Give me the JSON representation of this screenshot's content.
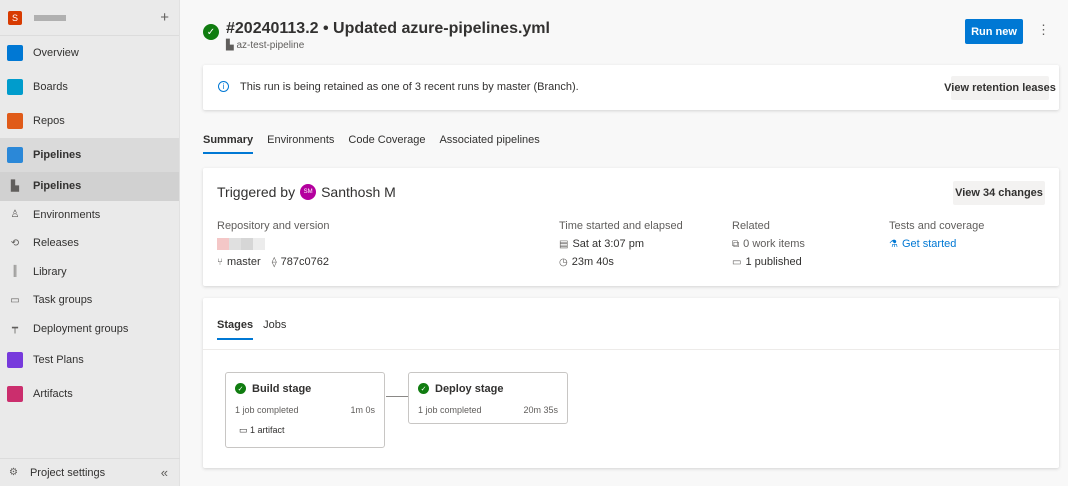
{
  "sidebar": {
    "org_letter": "S",
    "add_glyph": "+",
    "items": [
      {
        "label": "Overview",
        "icon": "overview-icon",
        "color": "#0078d4"
      },
      {
        "label": "Boards",
        "icon": "boards-icon",
        "color": "#009ccc"
      },
      {
        "label": "Repos",
        "icon": "repos-icon",
        "color": "#e05b19"
      },
      {
        "label": "Pipelines",
        "icon": "pipelines-icon",
        "color": "#2b88d8"
      }
    ],
    "sub_items": [
      {
        "label": "Pipelines",
        "icon": "pipelines-sub-icon"
      },
      {
        "label": "Environments",
        "icon": "environments-icon"
      },
      {
        "label": "Releases",
        "icon": "releases-icon"
      },
      {
        "label": "Library",
        "icon": "library-icon"
      },
      {
        "label": "Task groups",
        "icon": "task-groups-icon"
      },
      {
        "label": "Deployment groups",
        "icon": "deployment-groups-icon"
      }
    ],
    "items_after": [
      {
        "label": "Test Plans",
        "icon": "test-plans-icon",
        "color": "#773adc"
      },
      {
        "label": "Artifacts",
        "icon": "artifacts-icon",
        "color": "#cb2e6d"
      }
    ],
    "settings_label": "Project settings",
    "collapse_glyph": "«"
  },
  "header": {
    "title": "#20240113.2 • Updated azure-pipelines.yml",
    "pipeline_name": "az-test-pipeline",
    "run_new_label": "Run new",
    "more_glyph": "⋮"
  },
  "banner": {
    "text": "This run is being retained as one of 3 recent runs by master (Branch).",
    "button_label": "View retention leases"
  },
  "tabs": [
    "Summary",
    "Environments",
    "Code Coverage",
    "Associated pipelines"
  ],
  "summary": {
    "triggered_prefix": "Triggered by",
    "avatar_initials": "SM",
    "user_name": "Santhosh M",
    "changes_button": "View 34 changes",
    "repo_label": "Repository and version",
    "branch": "master",
    "commit": "787c0762",
    "time_label": "Time started and elapsed",
    "started": "Sat at 3:07 pm",
    "elapsed": "23m 40s",
    "related_label": "Related",
    "work_items": "0 work items",
    "published": "1 published",
    "tests_label": "Tests and coverage",
    "get_started": "Get started"
  },
  "stages_tabs": [
    "Stages",
    "Jobs"
  ],
  "stages": [
    {
      "name": "Build stage",
      "jobs": "1 job completed",
      "duration": "1m 0s",
      "artifact": "1 artifact"
    },
    {
      "name": "Deploy stage",
      "jobs": "1 job completed",
      "duration": "20m 35s"
    }
  ],
  "colors": {
    "accent": "#0078d4",
    "success": "#107c10",
    "avatar": "#b4009e"
  }
}
